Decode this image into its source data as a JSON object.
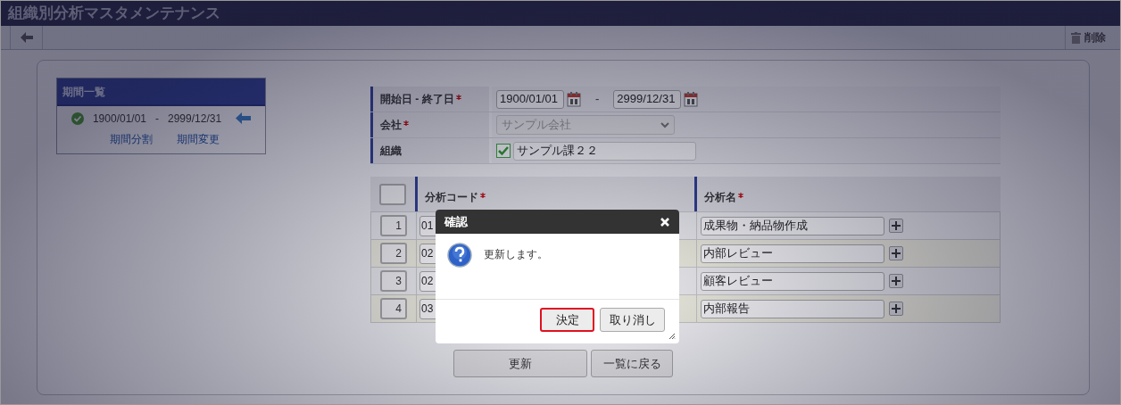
{
  "window": {
    "title": "組織別分析マスタメンテナンス"
  },
  "toolbar": {
    "delete_label": "削除"
  },
  "period_list": {
    "title": "期間一覧",
    "periods": [
      {
        "start": "1900/01/01",
        "separator": "-",
        "end": "2999/12/31",
        "active": true
      }
    ],
    "links": [
      "期間分割",
      "期間変更"
    ]
  },
  "form": {
    "date_range": {
      "label": "開始日 - 終了日",
      "required": true,
      "start": "1900/01/01",
      "separator": "-",
      "end": "2999/12/31"
    },
    "company": {
      "label": "会社",
      "required": true,
      "value": "サンプル会社",
      "disabled": true
    },
    "organization": {
      "label": "組織",
      "required": false,
      "checked": true,
      "value": "サンプル課２２"
    }
  },
  "table": {
    "select_all": false,
    "columns": [
      {
        "label": "分析コード",
        "required": true
      },
      {
        "label": "分析名",
        "required": true
      }
    ],
    "rows": [
      {
        "number": "1",
        "code": "01",
        "name": "成果物・納品物作成"
      },
      {
        "number": "2",
        "code": "02",
        "name": "内部レビュー"
      },
      {
        "number": "3",
        "code": "02",
        "name": "顧客レビュー"
      },
      {
        "number": "4",
        "code": "03",
        "name": "内部報告"
      }
    ]
  },
  "buttons": [
    "更新",
    "一覧に戻る"
  ],
  "dialog": {
    "title": "確認",
    "message": "更新します。",
    "buttons": [
      {
        "label": "決定",
        "focused": true
      },
      {
        "label": "取り消し",
        "focused": false
      }
    ]
  }
}
